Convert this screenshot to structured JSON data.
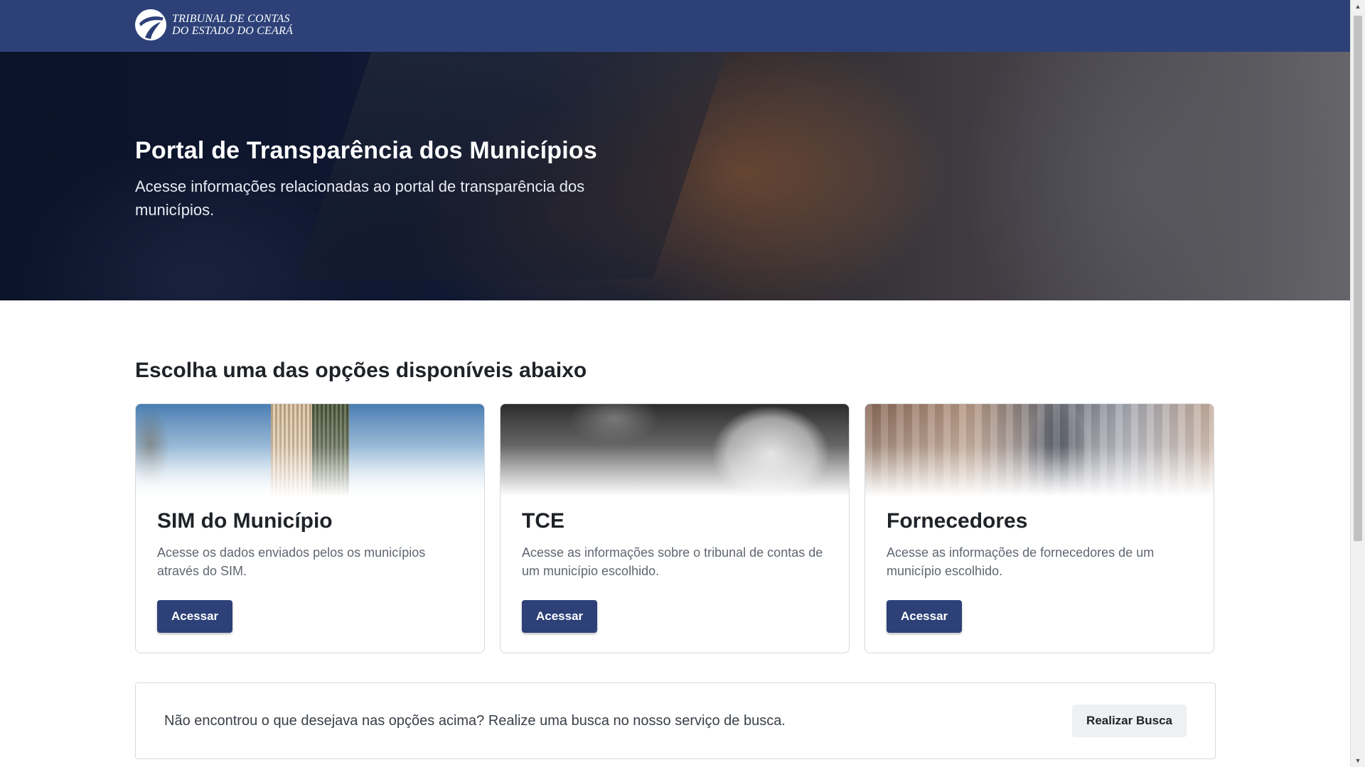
{
  "header": {
    "logo_line1": "TRIBUNAL DE CONTAS",
    "logo_line2": "DO ESTADO DO CEARÁ"
  },
  "hero": {
    "title": "Portal de Transparência dos Municípios",
    "subtitle": "Acesse informações relacionadas ao portal de transparência dos municípios."
  },
  "main": {
    "section_title": "Escolha uma das opções disponíveis abaixo",
    "cards": [
      {
        "title": "SIM do Município",
        "description": "Acesse os dados enviados pelos os municípios através do SIM.",
        "button": "Acessar"
      },
      {
        "title": "TCE",
        "description": "Acesse as informações sobre o tribunal de contas de um município escolhido.",
        "button": "Acessar"
      },
      {
        "title": "Fornecedores",
        "description": "Acesse as informações de fornecedores de um município escolhido.",
        "button": "Acessar"
      }
    ],
    "search_prompt": "Não encontrou o que desejava nas opções acima? Realize uma busca no nosso serviço de busca.",
    "search_button": "Realizar Busca"
  },
  "colors": {
    "brand": "#2d4178",
    "search_button_bg": "#eef0f3"
  },
  "icons": {
    "logo": "tce-ce-logo-icon",
    "scroll_up": "triangle-up-icon",
    "scroll_down": "triangle-down-icon"
  }
}
